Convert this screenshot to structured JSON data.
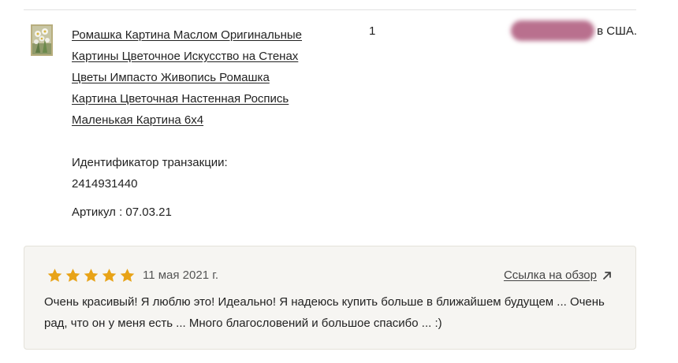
{
  "item": {
    "title": "Ромашка Картина Маслом Оригинальные Картины Цветочное Искусство на Стенах Цветы Импасто Живопись Ромашка Картина Цветочная Настенная Роспись Маленькая Картина 6х4",
    "transaction_label": "Идентификатор транзакции:",
    "transaction_id": "2414931440",
    "article": "Артикул : 07.03.21",
    "quantity": "1",
    "price_visible_suffix": "в США."
  },
  "review": {
    "rating": 5,
    "rating_max": 5,
    "star_color": "#e8a317",
    "date": "11 мая 2021 г.",
    "link_label": "Ссылка на обзор",
    "text": "Очень красивый! Я люблю это! Идеально! Я надеюсь купить больше в ближайшем будущем ... Очень рад, что он у меня есть ... Много благословений и большое спасибо ... :)"
  },
  "icons": {
    "star": "star-icon",
    "arrow": "external-arrow-icon"
  }
}
